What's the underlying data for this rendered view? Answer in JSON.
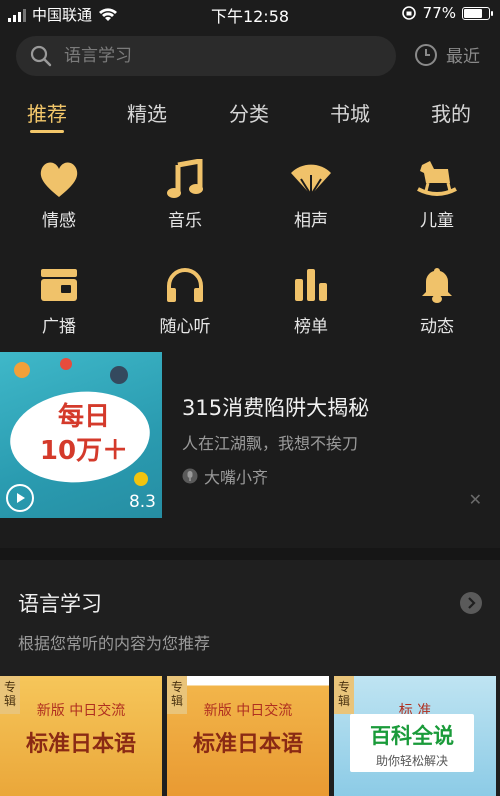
{
  "status_bar": {
    "carrier": "中国联通",
    "time": "下午12:58",
    "battery": "77%",
    "battery_level": 0.77
  },
  "search": {
    "placeholder": "语言学习",
    "recent_label": "最近"
  },
  "tabs": [
    {
      "label": "推荐",
      "active": true
    },
    {
      "label": "精选",
      "active": false
    },
    {
      "label": "分类",
      "active": false
    },
    {
      "label": "书城",
      "active": false
    },
    {
      "label": "我的",
      "active": false
    }
  ],
  "categories": [
    {
      "label": "情感",
      "icon": "heart-icon"
    },
    {
      "label": "音乐",
      "icon": "music-note-icon"
    },
    {
      "label": "相声",
      "icon": "fan-icon"
    },
    {
      "label": "儿童",
      "icon": "rocking-horse-icon"
    },
    {
      "label": "广播",
      "icon": "radio-icon"
    },
    {
      "label": "随心听",
      "icon": "headphones-icon"
    },
    {
      "label": "榜单",
      "icon": "bar-chart-icon"
    },
    {
      "label": "动态",
      "icon": "bell-icon"
    }
  ],
  "feature": {
    "cover_text_1": "每日",
    "cover_text_2": "10万＋",
    "score": "8.3",
    "title": "315消费陷阱大揭秘",
    "subtitle": "人在江湖飘，我想不挨刀",
    "author": "大嘴小齐",
    "close_glyph": "✕"
  },
  "section": {
    "title": "语言学习",
    "description": "根据您常听的内容为您推荐",
    "books": [
      {
        "tag": "专辑",
        "top": "新版 中日交流",
        "title": "标准日本语"
      },
      {
        "tag": "专辑",
        "top": "新版 中日交流",
        "title": "标准日本语"
      },
      {
        "tag": "专辑",
        "top": "标 准",
        "title": ""
      }
    ]
  },
  "watermark": {
    "title": "百科全说",
    "subtitle": "助你轻松解决"
  },
  "colors": {
    "accent": "#f3c76a",
    "background": "#1c1c1c"
  }
}
